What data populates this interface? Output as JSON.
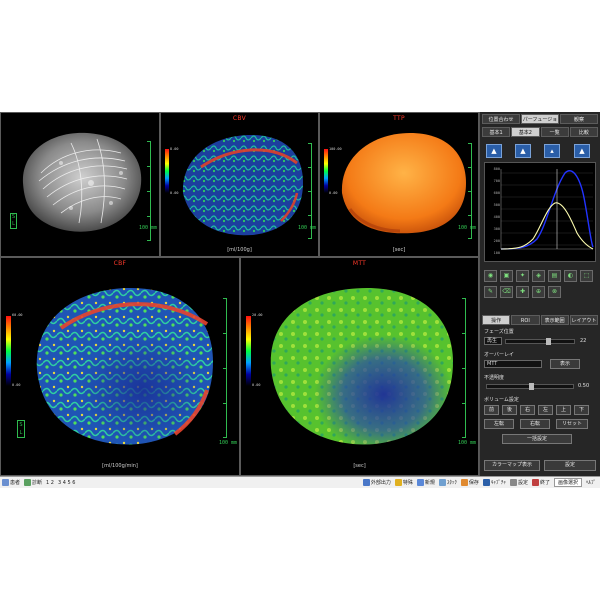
{
  "viewports": {
    "vr": {
      "title": ""
    },
    "cbv": {
      "title": "CBV",
      "unit": "[ml/100g]",
      "scale": "100 mm",
      "cbar_top": "8.00",
      "cbar_bottom": "0.00"
    },
    "ttp": {
      "title": "TTP",
      "unit": "[sec]",
      "scale": "100 mm",
      "cbar_top": "100.00",
      "cbar_bottom": "0.00"
    },
    "cbf": {
      "title": "CBF",
      "unit": "[ml/100g/min]",
      "scale": "100 mm",
      "cbar_top": "60.00",
      "cbar_bottom": "0.00"
    },
    "mtt": {
      "title": "MTT",
      "unit": "[sec]",
      "scale": "100 mm",
      "cbar_top": "20.00",
      "cbar_bottom": "0.00"
    },
    "orient": {
      "s": "S",
      "l": "L"
    },
    "vr_scale": "100 mm"
  },
  "panel": {
    "top_tabs": [
      "位置合わせ",
      "パーフュージョン",
      "観察"
    ],
    "sub_tabs": [
      "基本1",
      "基本2",
      "一覧",
      "比較"
    ],
    "graph_ticks": [
      "800",
      "700",
      "600",
      "500",
      "400",
      "300",
      "200",
      "100"
    ],
    "section_tabs": [
      "操作",
      "ROI",
      "表示範囲",
      "レイアウト"
    ],
    "phase_label": "フェーズ位置",
    "phase_field": "再生",
    "phase_value": "22",
    "overlay_label": "オーバーレイ",
    "overlay_select": "MTT",
    "overlay_button": "表示",
    "opacity_label": "不透明度",
    "opacity_value": "0.50",
    "volume_label": "ボリューム設定",
    "direction_buttons": [
      "前",
      "後",
      "右",
      "左",
      "上",
      "下"
    ],
    "rotate_buttons": [
      "左転",
      "右転",
      "リセット"
    ],
    "batch_button": "一括設定",
    "colormap_button": "カラーマップ表示",
    "settings_button": "設定"
  },
  "taskbar": {
    "items": [
      "患者",
      "診断",
      "1 2",
      "3 4 5 6"
    ],
    "right_items": [
      "外部出力",
      "特殊",
      "新規",
      "ｽﾀｯｸ",
      "保存",
      "ｷｬﾌﾟﾁｬ",
      "設定",
      "終了",
      "画像選択",
      "ﾍﾙﾌﾟ"
    ]
  }
}
